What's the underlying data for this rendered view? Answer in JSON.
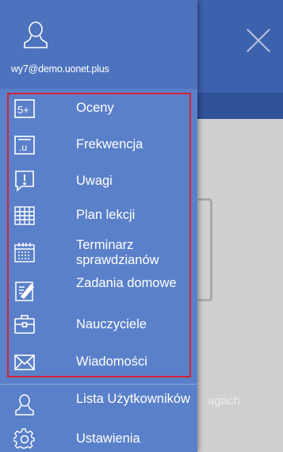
{
  "background": {
    "hint_text": "agach"
  },
  "account": {
    "email": "wy7@demo.uonet.plus"
  },
  "menu": [
    {
      "label": "Oceny",
      "icon": "grades-icon"
    },
    {
      "label": "Frekwencja",
      "icon": "attendance-icon"
    },
    {
      "label": "Uwagi",
      "icon": "notes-icon"
    },
    {
      "label": "Plan lekcji",
      "icon": "timetable-icon"
    },
    {
      "label": "Terminarz sprawdzianów",
      "icon": "calendar-icon"
    },
    {
      "label": "Zadania domowe",
      "icon": "homework-icon"
    },
    {
      "label": "Nauczyciele",
      "icon": "briefcase-icon"
    },
    {
      "label": "Wiadomości",
      "icon": "envelope-icon"
    }
  ],
  "secondary_menu": [
    {
      "label": "Lista Użytkowników",
      "icon": "user-list-icon"
    },
    {
      "label": "Ustawienia",
      "icon": "gear-icon"
    }
  ],
  "colors": {
    "drawer": "#5a80c9",
    "drawer_header": "#4e73be",
    "highlight_border": "#d62235",
    "app_header": "#3d62ad"
  }
}
